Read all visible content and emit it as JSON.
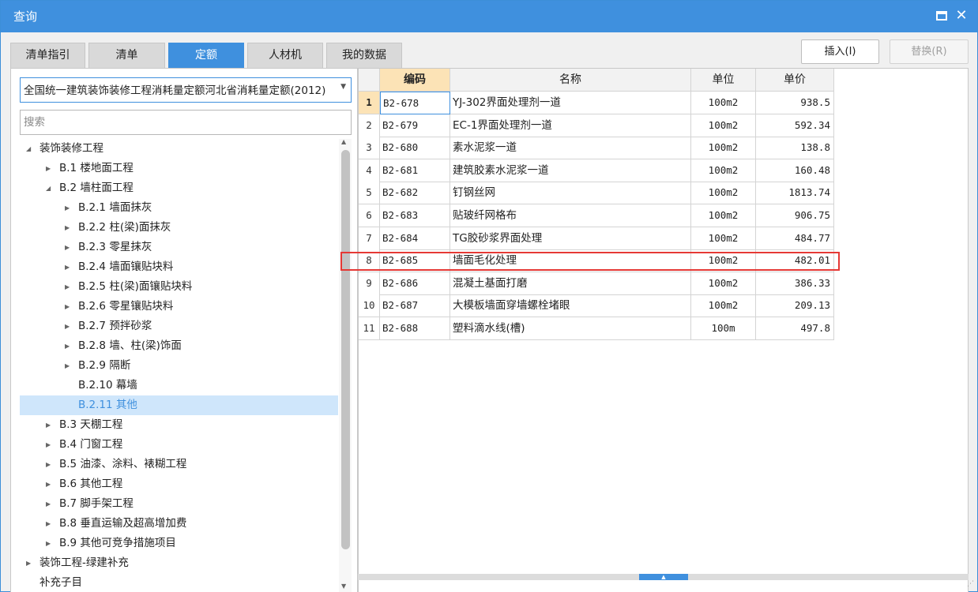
{
  "window": {
    "title": "查询"
  },
  "tabs": [
    {
      "label": "清单指引"
    },
    {
      "label": "清单"
    },
    {
      "label": "定额"
    },
    {
      "label": "人材机"
    },
    {
      "label": "我的数据"
    }
  ],
  "actions": {
    "insert": "插入(I)",
    "replace": "替换(R)"
  },
  "left": {
    "library": "全国统一建筑装饰装修工程消耗量定额河北省消耗量定额(2012)",
    "search_placeholder": "搜索",
    "tree": [
      {
        "label": "装饰装修工程",
        "level": 0,
        "toggle": "◢",
        "selected": false
      },
      {
        "label": "B.1 楼地面工程",
        "level": 1,
        "toggle": "▶",
        "selected": false
      },
      {
        "label": "B.2 墙柱面工程",
        "level": 1,
        "toggle": "◢",
        "selected": false
      },
      {
        "label": "B.2.1 墙面抹灰",
        "level": 2,
        "toggle": "▶",
        "selected": false
      },
      {
        "label": "B.2.2 柱(梁)面抹灰",
        "level": 2,
        "toggle": "▶",
        "selected": false
      },
      {
        "label": "B.2.3 零星抹灰",
        "level": 2,
        "toggle": "▶",
        "selected": false
      },
      {
        "label": "B.2.4 墙面镶贴块料",
        "level": 2,
        "toggle": "▶",
        "selected": false
      },
      {
        "label": "B.2.5 柱(梁)面镶贴块料",
        "level": 2,
        "toggle": "▶",
        "selected": false
      },
      {
        "label": "B.2.6 零星镶贴块料",
        "level": 2,
        "toggle": "▶",
        "selected": false
      },
      {
        "label": "B.2.7 预拌砂浆",
        "level": 2,
        "toggle": "▶",
        "selected": false
      },
      {
        "label": "B.2.8 墙、柱(梁)饰面",
        "level": 2,
        "toggle": "▶",
        "selected": false
      },
      {
        "label": "B.2.9 隔断",
        "level": 2,
        "toggle": "▶",
        "selected": false
      },
      {
        "label": "B.2.10 幕墙",
        "level": 2,
        "toggle": "",
        "selected": false
      },
      {
        "label": "B.2.11 其他",
        "level": 2,
        "toggle": "",
        "selected": true
      },
      {
        "label": "B.3 天棚工程",
        "level": 1,
        "toggle": "▶",
        "selected": false
      },
      {
        "label": "B.4 门窗工程",
        "level": 1,
        "toggle": "▶",
        "selected": false
      },
      {
        "label": "B.5 油漆、涂料、裱糊工程",
        "level": 1,
        "toggle": "▶",
        "selected": false
      },
      {
        "label": "B.6 其他工程",
        "level": 1,
        "toggle": "▶",
        "selected": false
      },
      {
        "label": "B.7 脚手架工程",
        "level": 1,
        "toggle": "▶",
        "selected": false
      },
      {
        "label": "B.8 垂直运输及超高增加费",
        "level": 1,
        "toggle": "▶",
        "selected": false
      },
      {
        "label": "B.9 其他可竞争措施项目",
        "level": 1,
        "toggle": "▶",
        "selected": false
      },
      {
        "label": "装饰工程-绿建补充",
        "level": 0,
        "toggle": "▶",
        "selected": false
      },
      {
        "label": "补充子目",
        "level": 0,
        "toggle": "",
        "selected": false
      }
    ]
  },
  "grid": {
    "headers": {
      "code": "编码",
      "name": "名称",
      "unit": "单位",
      "price": "单价"
    },
    "rows": [
      {
        "no": "1",
        "code": "B2-678",
        "name": "YJ-302界面处理剂一道",
        "unit": "100m2",
        "price": "938.5"
      },
      {
        "no": "2",
        "code": "B2-679",
        "name": "EC-1界面处理剂一道",
        "unit": "100m2",
        "price": "592.34"
      },
      {
        "no": "3",
        "code": "B2-680",
        "name": "素水泥浆一道",
        "unit": "100m2",
        "price": "138.8"
      },
      {
        "no": "4",
        "code": "B2-681",
        "name": "建筑胶素水泥浆一道",
        "unit": "100m2",
        "price": "160.48"
      },
      {
        "no": "5",
        "code": "B2-682",
        "name": "钉钢丝网",
        "unit": "100m2",
        "price": "1813.74"
      },
      {
        "no": "6",
        "code": "B2-683",
        "name": "贴玻纤网格布",
        "unit": "100m2",
        "price": "906.75"
      },
      {
        "no": "7",
        "code": "B2-684",
        "name": "TG胶砂浆界面处理",
        "unit": "100m2",
        "price": "484.77"
      },
      {
        "no": "8",
        "code": "B2-685",
        "name": "墙面毛化处理",
        "unit": "100m2",
        "price": "482.01"
      },
      {
        "no": "9",
        "code": "B2-686",
        "name": "混凝土基面打磨",
        "unit": "100m2",
        "price": "386.33"
      },
      {
        "no": "10",
        "code": "B2-687",
        "name": "大模板墙面穿墙螺栓堵眼",
        "unit": "100m2",
        "price": "209.13"
      },
      {
        "no": "11",
        "code": "B2-688",
        "name": "塑料滴水线(槽)",
        "unit": "100m",
        "price": "497.8"
      }
    ]
  }
}
